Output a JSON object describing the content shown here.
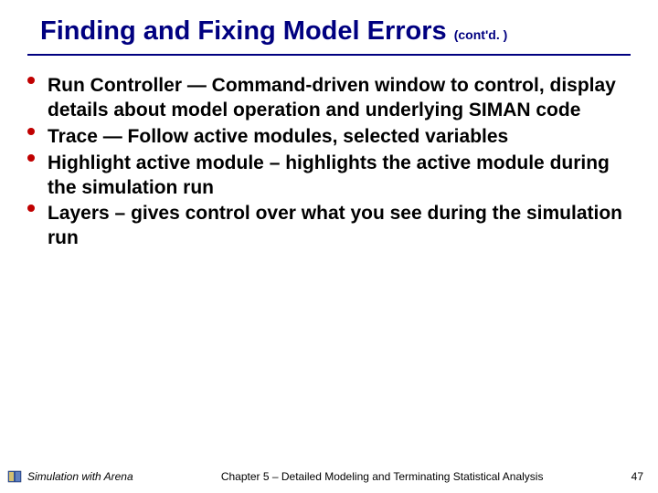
{
  "title": {
    "main": "Finding and Fixing Model Errors",
    "suffix": "(cont'd. )"
  },
  "bullets": [
    "Run Controller — Command-driven window to control, display details about model operation and underlying SIMAN code",
    "Trace — Follow active modules, selected variables",
    "Highlight active module – highlights the active module during the simulation run",
    "Layers – gives control over what you see during the simulation run"
  ],
  "footer": {
    "left": "Simulation with Arena",
    "center": "Chapter 5 – Detailed Modeling and Terminating Statistical Analysis",
    "page": "47"
  }
}
